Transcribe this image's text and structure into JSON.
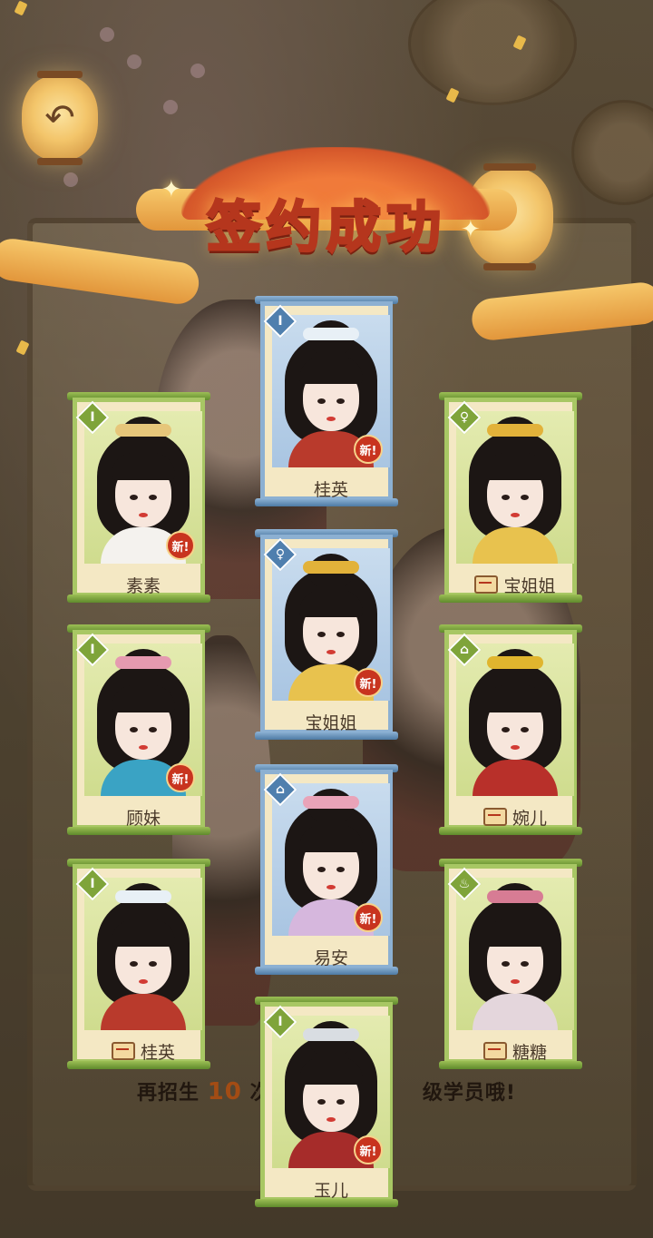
{
  "title": "签约成功",
  "hint": {
    "prefix": "再招生",
    "number": "10",
    "middle": "次",
    "suffix": "级学员哦!"
  },
  "new_badge": "新!",
  "colors": {
    "title_fill": "#ffe9b0",
    "title_stroke": "#b5361d",
    "card_green": "#a8c764",
    "card_blue": "#8cb0d2",
    "badge_red": "#c8341f"
  },
  "cards": [
    {
      "name": "桂英",
      "rarity": "blue",
      "is_new": true,
      "has_scroll_icon": false
    },
    {
      "name": "素素",
      "rarity": "green",
      "is_new": true,
      "has_scroll_icon": false
    },
    {
      "name": "宝姐姐",
      "rarity": "green",
      "is_new": false,
      "has_scroll_icon": true
    },
    {
      "name": "宝姐姐",
      "rarity": "blue",
      "is_new": true,
      "has_scroll_icon": false
    },
    {
      "name": "顾妹",
      "rarity": "green",
      "is_new": true,
      "has_scroll_icon": false
    },
    {
      "name": "婉儿",
      "rarity": "green",
      "is_new": false,
      "has_scroll_icon": true
    },
    {
      "name": "易安",
      "rarity": "blue",
      "is_new": true,
      "has_scroll_icon": false
    },
    {
      "name": "桂英",
      "rarity": "green",
      "is_new": false,
      "has_scroll_icon": true
    },
    {
      "name": "糖糖",
      "rarity": "green",
      "is_new": false,
      "has_scroll_icon": true
    },
    {
      "name": "玉儿",
      "rarity": "green",
      "is_new": true,
      "has_scroll_icon": false
    }
  ]
}
